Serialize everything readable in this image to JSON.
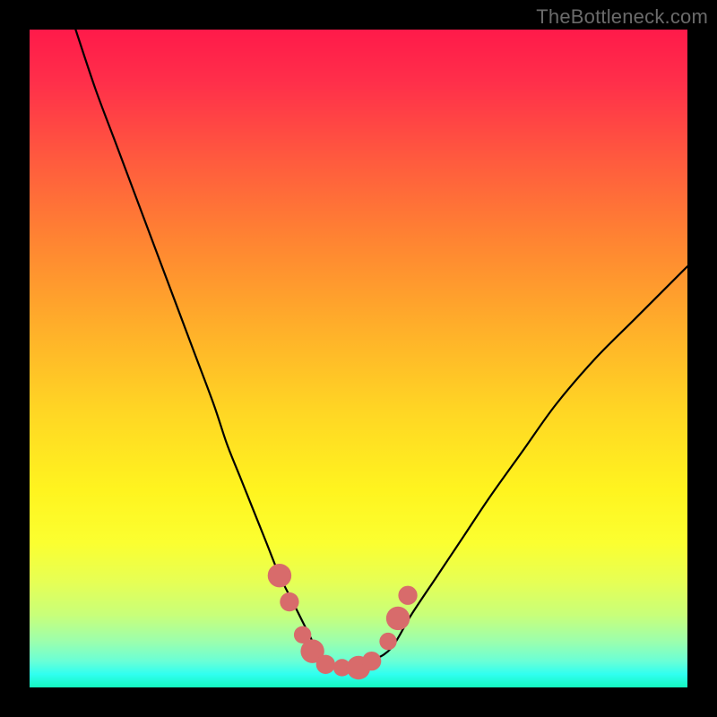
{
  "watermark": {
    "text": "TheBottleneck.com"
  },
  "colors": {
    "curve_stroke": "#000000",
    "marker_fill": "#d86b6b",
    "frame_bg": "#000000"
  },
  "chart_data": {
    "type": "line",
    "title": "",
    "xlabel": "",
    "ylabel": "",
    "xlim": [
      0,
      100
    ],
    "ylim": [
      0,
      100
    ],
    "grid": false,
    "legend": false,
    "series": [
      {
        "name": "bottleneck-curve",
        "x": [
          7,
          10,
          13,
          16,
          19,
          22,
          25,
          28,
          30,
          32,
          34,
          36,
          38,
          40,
          41,
          42,
          43,
          44,
          45,
          46,
          48,
          50,
          52,
          55,
          58,
          62,
          66,
          70,
          75,
          80,
          86,
          92,
          100
        ],
        "y": [
          100,
          91,
          83,
          75,
          67,
          59,
          51,
          43,
          37,
          32,
          27,
          22,
          17,
          13,
          11,
          9,
          7,
          5,
          4,
          3,
          3,
          3,
          4,
          6,
          11,
          17,
          23,
          29,
          36,
          43,
          50,
          56,
          64
        ]
      }
    ],
    "markers": [
      {
        "x": 38.0,
        "y": 17.0
      },
      {
        "x": 39.5,
        "y": 13.0
      },
      {
        "x": 41.5,
        "y": 8.0
      },
      {
        "x": 43.0,
        "y": 5.5
      },
      {
        "x": 45.0,
        "y": 3.5
      },
      {
        "x": 47.5,
        "y": 3.0
      },
      {
        "x": 50.0,
        "y": 3.0
      },
      {
        "x": 52.0,
        "y": 4.0
      },
      {
        "x": 54.5,
        "y": 7.0
      },
      {
        "x": 56.0,
        "y": 10.5
      },
      {
        "x": 57.5,
        "y": 14.0
      }
    ],
    "marker_radius_large": 1.8,
    "marker_radius_small": 1.1
  }
}
